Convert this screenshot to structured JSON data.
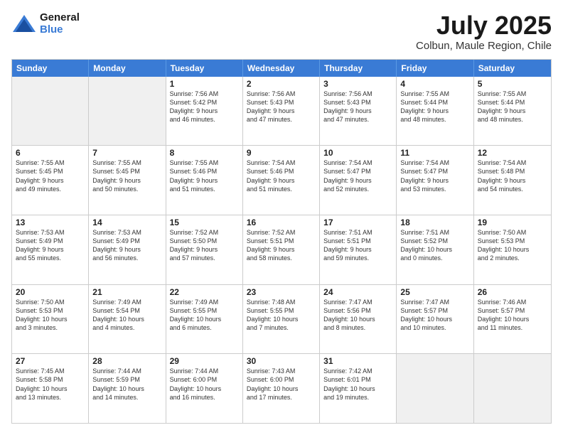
{
  "logo": {
    "line1": "General",
    "line2": "Blue"
  },
  "title": "July 2025",
  "subtitle": "Colbun, Maule Region, Chile",
  "header_days": [
    "Sunday",
    "Monday",
    "Tuesday",
    "Wednesday",
    "Thursday",
    "Friday",
    "Saturday"
  ],
  "weeks": [
    [
      {
        "day": "",
        "info": "",
        "shaded": true
      },
      {
        "day": "",
        "info": "",
        "shaded": true
      },
      {
        "day": "1",
        "info": "Sunrise: 7:56 AM\nSunset: 5:42 PM\nDaylight: 9 hours\nand 46 minutes."
      },
      {
        "day": "2",
        "info": "Sunrise: 7:56 AM\nSunset: 5:43 PM\nDaylight: 9 hours\nand 47 minutes."
      },
      {
        "day": "3",
        "info": "Sunrise: 7:56 AM\nSunset: 5:43 PM\nDaylight: 9 hours\nand 47 minutes."
      },
      {
        "day": "4",
        "info": "Sunrise: 7:55 AM\nSunset: 5:44 PM\nDaylight: 9 hours\nand 48 minutes."
      },
      {
        "day": "5",
        "info": "Sunrise: 7:55 AM\nSunset: 5:44 PM\nDaylight: 9 hours\nand 48 minutes."
      }
    ],
    [
      {
        "day": "6",
        "info": "Sunrise: 7:55 AM\nSunset: 5:45 PM\nDaylight: 9 hours\nand 49 minutes."
      },
      {
        "day": "7",
        "info": "Sunrise: 7:55 AM\nSunset: 5:45 PM\nDaylight: 9 hours\nand 50 minutes."
      },
      {
        "day": "8",
        "info": "Sunrise: 7:55 AM\nSunset: 5:46 PM\nDaylight: 9 hours\nand 51 minutes."
      },
      {
        "day": "9",
        "info": "Sunrise: 7:54 AM\nSunset: 5:46 PM\nDaylight: 9 hours\nand 51 minutes."
      },
      {
        "day": "10",
        "info": "Sunrise: 7:54 AM\nSunset: 5:47 PM\nDaylight: 9 hours\nand 52 minutes."
      },
      {
        "day": "11",
        "info": "Sunrise: 7:54 AM\nSunset: 5:47 PM\nDaylight: 9 hours\nand 53 minutes."
      },
      {
        "day": "12",
        "info": "Sunrise: 7:54 AM\nSunset: 5:48 PM\nDaylight: 9 hours\nand 54 minutes."
      }
    ],
    [
      {
        "day": "13",
        "info": "Sunrise: 7:53 AM\nSunset: 5:49 PM\nDaylight: 9 hours\nand 55 minutes."
      },
      {
        "day": "14",
        "info": "Sunrise: 7:53 AM\nSunset: 5:49 PM\nDaylight: 9 hours\nand 56 minutes."
      },
      {
        "day": "15",
        "info": "Sunrise: 7:52 AM\nSunset: 5:50 PM\nDaylight: 9 hours\nand 57 minutes."
      },
      {
        "day": "16",
        "info": "Sunrise: 7:52 AM\nSunset: 5:51 PM\nDaylight: 9 hours\nand 58 minutes."
      },
      {
        "day": "17",
        "info": "Sunrise: 7:51 AM\nSunset: 5:51 PM\nDaylight: 9 hours\nand 59 minutes."
      },
      {
        "day": "18",
        "info": "Sunrise: 7:51 AM\nSunset: 5:52 PM\nDaylight: 10 hours\nand 0 minutes."
      },
      {
        "day": "19",
        "info": "Sunrise: 7:50 AM\nSunset: 5:53 PM\nDaylight: 10 hours\nand 2 minutes."
      }
    ],
    [
      {
        "day": "20",
        "info": "Sunrise: 7:50 AM\nSunset: 5:53 PM\nDaylight: 10 hours\nand 3 minutes."
      },
      {
        "day": "21",
        "info": "Sunrise: 7:49 AM\nSunset: 5:54 PM\nDaylight: 10 hours\nand 4 minutes."
      },
      {
        "day": "22",
        "info": "Sunrise: 7:49 AM\nSunset: 5:55 PM\nDaylight: 10 hours\nand 6 minutes."
      },
      {
        "day": "23",
        "info": "Sunrise: 7:48 AM\nSunset: 5:55 PM\nDaylight: 10 hours\nand 7 minutes."
      },
      {
        "day": "24",
        "info": "Sunrise: 7:47 AM\nSunset: 5:56 PM\nDaylight: 10 hours\nand 8 minutes."
      },
      {
        "day": "25",
        "info": "Sunrise: 7:47 AM\nSunset: 5:57 PM\nDaylight: 10 hours\nand 10 minutes."
      },
      {
        "day": "26",
        "info": "Sunrise: 7:46 AM\nSunset: 5:57 PM\nDaylight: 10 hours\nand 11 minutes."
      }
    ],
    [
      {
        "day": "27",
        "info": "Sunrise: 7:45 AM\nSunset: 5:58 PM\nDaylight: 10 hours\nand 13 minutes."
      },
      {
        "day": "28",
        "info": "Sunrise: 7:44 AM\nSunset: 5:59 PM\nDaylight: 10 hours\nand 14 minutes."
      },
      {
        "day": "29",
        "info": "Sunrise: 7:44 AM\nSunset: 6:00 PM\nDaylight: 10 hours\nand 16 minutes."
      },
      {
        "day": "30",
        "info": "Sunrise: 7:43 AM\nSunset: 6:00 PM\nDaylight: 10 hours\nand 17 minutes."
      },
      {
        "day": "31",
        "info": "Sunrise: 7:42 AM\nSunset: 6:01 PM\nDaylight: 10 hours\nand 19 minutes."
      },
      {
        "day": "",
        "info": "",
        "shaded": true
      },
      {
        "day": "",
        "info": "",
        "shaded": true
      }
    ]
  ]
}
